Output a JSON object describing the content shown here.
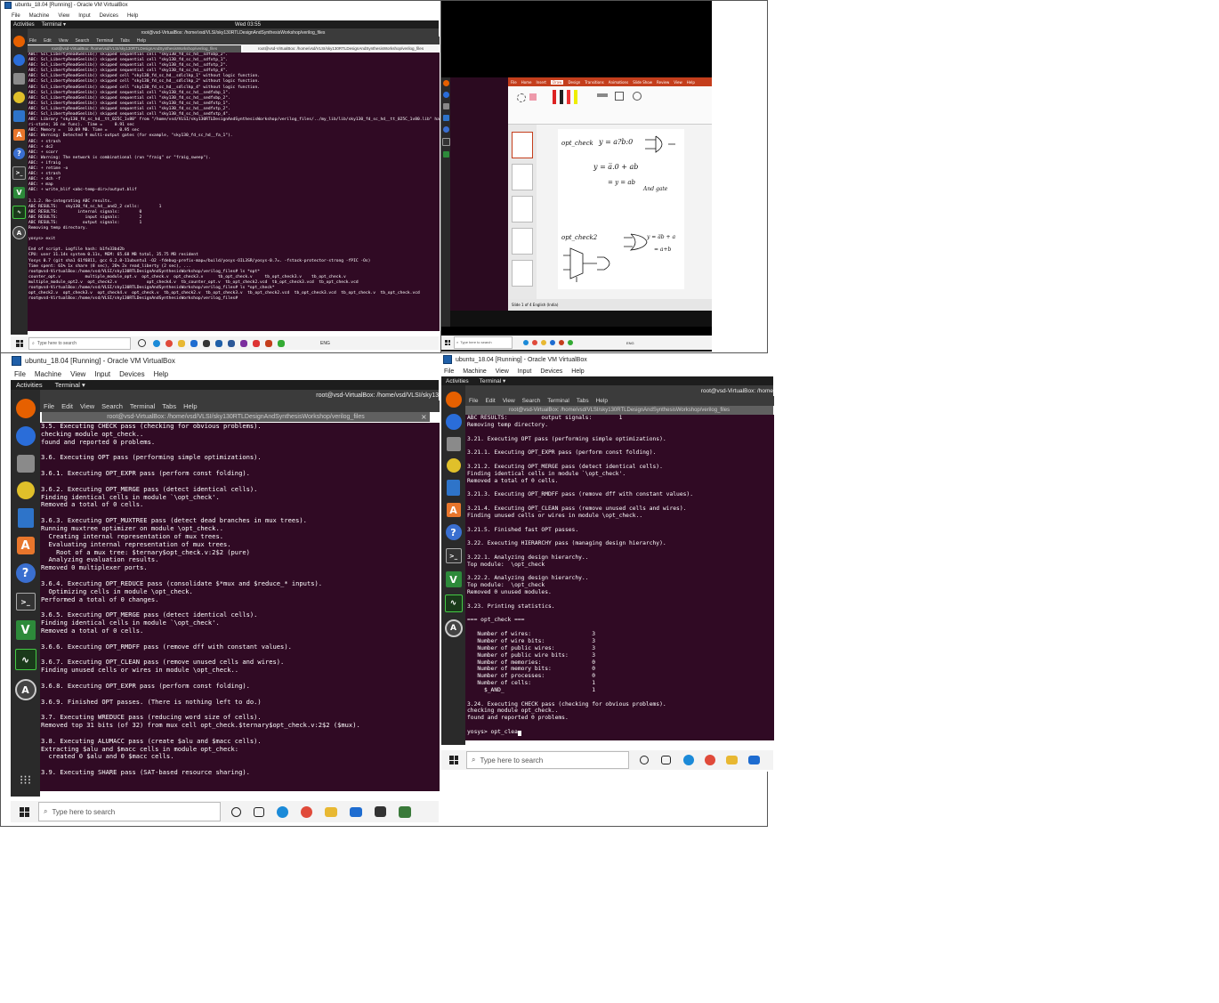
{
  "panel1": {
    "title": "ubuntu_18.04 [Running] - Oracle VM VirtualBox",
    "menu": [
      "File",
      "Machine",
      "View",
      "Input",
      "Devices",
      "Help"
    ],
    "activities": "Activities",
    "terminal_label": "Terminal ▾",
    "clock": "Wed 03:55",
    "window_title": "root@vsd-VirtualBox: /home/vsd/VLSI/sky130RTLDesignAndSynthesisWorkshop/verilog_files",
    "term_menu": [
      "File",
      "Edit",
      "View",
      "Search",
      "Terminal",
      "Tabs",
      "Help"
    ],
    "tab1": "root@vsd-VirtualBox: /home/vsd/VLSI/sky130RTLDesignAndSynthesisWorkshop/verilog_files",
    "tab2": "root@vsd-VirtualBox: /home/vsd/VLSI/sky130RTLDesignAndSynthesisWorkshop/verilog_files",
    "lines": [
      "ABC: Scl_LibertyReadGenlib() skipped sequential cell \"sky130_fd_sc_hd__sdfxbp_2\".",
      "ABC: Scl_LibertyReadGenlib() skipped sequential cell \"sky130_fd_sc_hd__sdfxtp_1\".",
      "ABC: Scl_LibertyReadGenlib() skipped sequential cell \"sky130_fd_sc_hd__sdfxtp_2\".",
      "ABC: Scl_LibertyReadGenlib() skipped sequential cell \"sky130_fd_sc_hd__sdfxtp_4\".",
      "ABC: Scl_LibertyReadGenlib() skipped cell \"sky130_fd_sc_hd__sdlclkp_1\" without logic function.",
      "ABC: Scl_LibertyReadGenlib() skipped cell \"sky130_fd_sc_hd__sdlclkp_2\" without logic function.",
      "ABC: Scl_LibertyReadGenlib() skipped cell \"sky130_fd_sc_hd__sdlclkp_4\" without logic function.",
      "ABC: Scl_LibertyReadGenlib() skipped sequential cell \"sky130_fd_sc_hd__sedfxbp_1\".",
      "ABC: Scl_LibertyReadGenlib() skipped sequential cell \"sky130_fd_sc_hd__sedfxbp_2\".",
      "ABC: Scl_LibertyReadGenlib() skipped sequential cell \"sky130_fd_sc_hd__sedfxtp_1\".",
      "ABC: Scl_LibertyReadGenlib() skipped sequential cell \"sky130_fd_sc_hd__sedfxtp_2\".",
      "ABC: Scl_LibertyReadGenlib() skipped sequential cell \"sky130_fd_sc_hd__sedfxtp_4\".",
      "ABC: Library \"sky130_fd_sc_hd__tt_025C_1v80\" from \"/home/vsd/VLSI/sky130RTLDesignAndSynthesisWorkshop/verilog_files/../my_lib/lib/sky130_fd_sc_hd__tt_025C_1v80.lib\" has 334 cells (94 skipped",
      "ri-state; 16 no func).  Time =     0.91 sec",
      "ABC: Memory =   10.09 MB. Time =     0.95 sec",
      "ABC: Warning: Detected 9 multi-output gates (for example, \"sky130_fd_sc_hd__fa_1\").",
      "ABC: + strash",
      "ABC: + dc2",
      "ABC: + scorr",
      "ABC: Warning: The network is combinational (run \"fraig\" or \"fraig_sweep\").",
      "ABC: + ifraig",
      "ABC: + retime -o",
      "ABC: + strash",
      "ABC: + dch -f",
      "ABC: + map",
      "ABC: + write_blif <abc-temp-dir>/output.blif",
      "",
      "3.1.2. Re-integrating ABC results.",
      "ABC RESULTS:   sky130_fd_sc_hd__and2_2 cells:        1",
      "ABC RESULTS:        internal signals:        0",
      "ABC RESULTS:           input signals:        2",
      "ABC RESULTS:          output signals:        1",
      "Removing temp directory.",
      "",
      "yosys> exit",
      "",
      "End of script. Logfile hash: b1fe33bd2b",
      "CPU: user 11.14s system 0.11s, MEM: 65.68 MB total, 35.75 MB resident",
      "Yosys 0.7 (git sha1 61f6811, gcc 6.2.0-11ubuntu1 -O2 -fdebug-prefix-map=/build/yosys-OIL3SR/yosys-0.7=. -fstack-protector-strong -fPIC -Os)",
      "Time spent: 61% 1x share (8 sec), 26% 2x read_liberty (2 sec), ...",
      "root@vsd-VirtualBox:/home/vsd/VLSI/sky130RTLDesignAndSynthesisWorkshop/verilog_files# ls *opt*",
      "counter_opt.v          multiple_module_opt.v  opt_check.v  opt_check3.v      tb_opt_check.v     tb_opt_check3.v    tb_opt_check.v",
      "multiple_module_opt2.v  opt_check2.v            opt_check4.v  tb_counter_opt.v  tb_opt_check2.vcd  tb_opt_check3.vcd  tb_opt_check.vcd",
      "root@vsd-VirtualBox:/home/vsd/VLSI/sky130RTLDesignAndSynthesisWorkshop/verilog_files# ls *opt_check*",
      "opt_check2.v  opt_check3.v  opt_check4.v  opt_check.v  tb_opt_check2.v  tb_opt_check3.v  tb_opt_check2.vcd  tb_opt_check3.vcd  tb_opt_check.v  tb_opt_check.vcd",
      "root@vsd-VirtualBox:/home/vsd/VLSI/sky130RTLDesignAndSynthesisWorkshop/verilog_files#"
    ],
    "taskbar_search": "Type here to search",
    "taskbar_time": "ENG"
  },
  "panel2": {
    "notes_title": "Tell me what you want to do",
    "notes_tabs": [
      "File",
      "Home",
      "Insert",
      "Draw",
      "Design",
      "Transitions",
      "Animations",
      "Slide Show",
      "Review",
      "View",
      "Help"
    ],
    "statusbar": "Slide 1 of 4    English (India)",
    "ink": {
      "eq1": "y = a?b:0",
      "eq2": "y = a̅.0 + ab",
      "eq3": "= y = ab",
      "label_and": "And gate",
      "eq4": "y = a̅b + a",
      "eq5": "= a+b",
      "title1": "opt_check",
      "title2": "opt_check2"
    },
    "taskbar_search": "Type here to search",
    "taskbar_time": "ENG"
  },
  "panel3": {
    "title": "ubuntu_18.04 [Running] - Oracle VM VirtualBox",
    "menu": [
      "File",
      "Machine",
      "View",
      "Input",
      "Devices",
      "Help"
    ],
    "activities": "Activities",
    "terminal_label": "Terminal ▾",
    "header_path": "root@vsd-VirtualBox: /home/vsd/VLSI/sky13",
    "term_menu": [
      "File",
      "Edit",
      "View",
      "Search",
      "Terminal",
      "Tabs",
      "Help"
    ],
    "tab": "root@vsd-VirtualBox: /home/vsd/VLSI/sky130RTLDesignAndSynthesisWorkshop/verilog_files",
    "lines": [
      "3.5. Executing CHECK pass (checking for obvious problems).",
      "checking module opt_check..",
      "found and reported 0 problems.",
      "",
      "3.6. Executing OPT pass (performing simple optimizations).",
      "",
      "3.6.1. Executing OPT_EXPR pass (perform const folding).",
      "",
      "3.6.2. Executing OPT_MERGE pass (detect identical cells).",
      "Finding identical cells in module `\\opt_check'.",
      "Removed a total of 0 cells.",
      "",
      "3.6.3. Executing OPT_MUXTREE pass (detect dead branches in mux trees).",
      "Running muxtree optimizer on module \\opt_check..",
      "  Creating internal representation of mux trees.",
      "  Evaluating internal representation of mux trees.",
      "    Root of a mux tree: $ternary$opt_check.v:2$2 (pure)",
      "  Analyzing evaluation results.",
      "Removed 0 multiplexer ports.",
      "",
      "3.6.4. Executing OPT_REDUCE pass (consolidate $*mux and $reduce_* inputs).",
      "  Optimizing cells in module \\opt_check.",
      "Performed a total of 0 changes.",
      "",
      "3.6.5. Executing OPT_MERGE pass (detect identical cells).",
      "Finding identical cells in module `\\opt_check'.",
      "Removed a total of 0 cells.",
      "",
      "3.6.6. Executing OPT_RMDFF pass (remove dff with constant values).",
      "",
      "3.6.7. Executing OPT_CLEAN pass (remove unused cells and wires).",
      "Finding unused cells or wires in module \\opt_check..",
      "",
      "3.6.8. Executing OPT_EXPR pass (perform const folding).",
      "",
      "3.6.9. Finished OPT passes. (There is nothing left to do.)",
      "",
      "3.7. Executing WREDUCE pass (reducing word size of cells).",
      "Removed top 31 bits (of 32) from mux cell opt_check.$ternary$opt_check.v:2$2 ($mux).",
      "",
      "3.8. Executing ALUMACC pass (create $alu and $macc cells).",
      "Extracting $alu and $macc cells in module opt_check:",
      "  created 0 $alu and 0 $macc cells.",
      "",
      "3.9. Executing SHARE pass (SAT-based resource sharing)."
    ],
    "taskbar_search": "Type here to search"
  },
  "panel4": {
    "title": "ubuntu_18.04 [Running] - Oracle VM VirtualBox",
    "menu": [
      "File",
      "Machine",
      "View",
      "Input",
      "Devices",
      "Help"
    ],
    "activities": "Activities",
    "terminal_label": "Terminal ▾",
    "header_path": "root@vsd-VirtualBox: /home",
    "term_menu": [
      "File",
      "Edit",
      "View",
      "Search",
      "Terminal",
      "Tabs",
      "Help"
    ],
    "tab": "root@vsd-VirtualBox: /home/vsd/VLSI/sky130RTLDesignAndSynthesisWorkshop/verilog_files",
    "lines": [
      "ABC RESULTS:          output signals:        1",
      "Removing temp directory.",
      "",
      "3.21. Executing OPT pass (performing simple optimizations).",
      "",
      "3.21.1. Executing OPT_EXPR pass (perform const folding).",
      "",
      "3.21.2. Executing OPT_MERGE pass (detect identical cells).",
      "Finding identical cells in module `\\opt_check'.",
      "Removed a total of 0 cells.",
      "",
      "3.21.3. Executing OPT_RMDFF pass (remove dff with constant values).",
      "",
      "3.21.4. Executing OPT_CLEAN pass (remove unused cells and wires).",
      "Finding unused cells or wires in module \\opt_check..",
      "",
      "3.21.5. Finished fast OPT passes.",
      "",
      "3.22. Executing HIERARCHY pass (managing design hierarchy).",
      "",
      "3.22.1. Analyzing design hierarchy..",
      "Top module:  \\opt_check",
      "",
      "3.22.2. Analyzing design hierarchy..",
      "Top module:  \\opt_check",
      "Removed 0 unused modules.",
      "",
      "3.23. Printing statistics.",
      "",
      "=== opt_check ===",
      "",
      "   Number of wires:                  3",
      "   Number of wire bits:              3",
      "   Number of public wires:           3",
      "   Number of public wire bits:       3",
      "   Number of memories:               0",
      "   Number of memory bits:            0",
      "   Number of processes:              0",
      "   Number of cells:                  1",
      "     $_AND_                          1",
      "",
      "3.24. Executing CHECK pass (checking for obvious problems).",
      "checking module opt_check..",
      "found and reported 0 problems.",
      "",
      "yosys> opt_clea"
    ],
    "taskbar_search": "Type here to search"
  },
  "colors": {
    "terminal_bg": "#300a24",
    "dock_bg": "#2a2a2a",
    "topbar_bg": "#1d1d1d",
    "ppt_accent": "#c43e1c"
  }
}
